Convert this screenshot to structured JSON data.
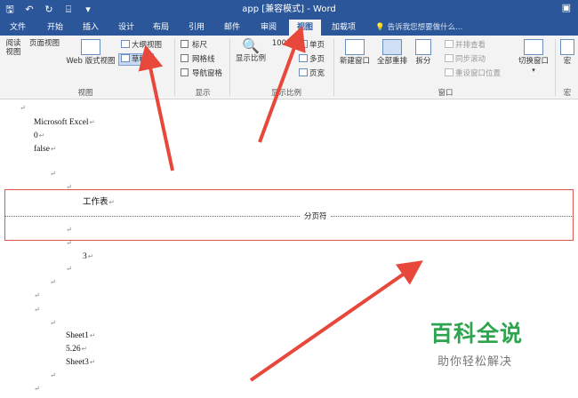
{
  "app": {
    "title": "app [兼容模式] - Word",
    "brand_color": "#2b579a"
  },
  "qat": {
    "save_icon": "save-icon",
    "undo_icon": "undo-icon",
    "redo_icon": "redo-icon",
    "format_painter_icon": "format-painter-icon",
    "customize_icon": "customize-qat-icon"
  },
  "tabs": [
    {
      "label": "文件"
    },
    {
      "label": "开始"
    },
    {
      "label": "插入"
    },
    {
      "label": "设计"
    },
    {
      "label": "布局"
    },
    {
      "label": "引用"
    },
    {
      "label": "邮件"
    },
    {
      "label": "审阅"
    },
    {
      "label": "视图"
    },
    {
      "label": "加载项"
    }
  ],
  "active_tab": "视图",
  "tell_me": "告诉我您想要做什么...",
  "ribbon": {
    "views": {
      "read_mode": "阅读\n视图",
      "print_layout": "页面视图",
      "web_layout": "Web 版式视图",
      "outline": "大纲视图",
      "draft": "草稿",
      "group_label": "视图"
    },
    "show": {
      "ruler": "标尺",
      "gridlines": "网格线",
      "nav_pane": "导航窗格",
      "group_label": "显示"
    },
    "zoom": {
      "zoom": "显示比例",
      "hundred": "100%",
      "one_page": "单页",
      "multi_page": "多页",
      "page_width": "页宽",
      "group_label": "显示比例"
    },
    "window": {
      "new_window": "新建窗口",
      "arrange_all": "全部重排",
      "split": "拆分",
      "side_by_side": "并排查看",
      "sync_scroll": "同步滚动",
      "reset_pos": "重设窗口位置",
      "switch_windows": "切换窗口",
      "group_label": "窗口"
    },
    "macros": {
      "macros": "宏",
      "group_label": "宏"
    }
  },
  "document": {
    "lines": [
      "Microsoft Excel",
      "0",
      "false",
      "工作表",
      "3",
      "Sheet1",
      "5.26",
      "Sheet3"
    ],
    "page_break_label": "分页符",
    "paragraph_mark": "↵"
  },
  "watermark": {
    "title": "百科全说",
    "subtitle": "助你轻松解决"
  },
  "annotation_color": "#e8473c"
}
